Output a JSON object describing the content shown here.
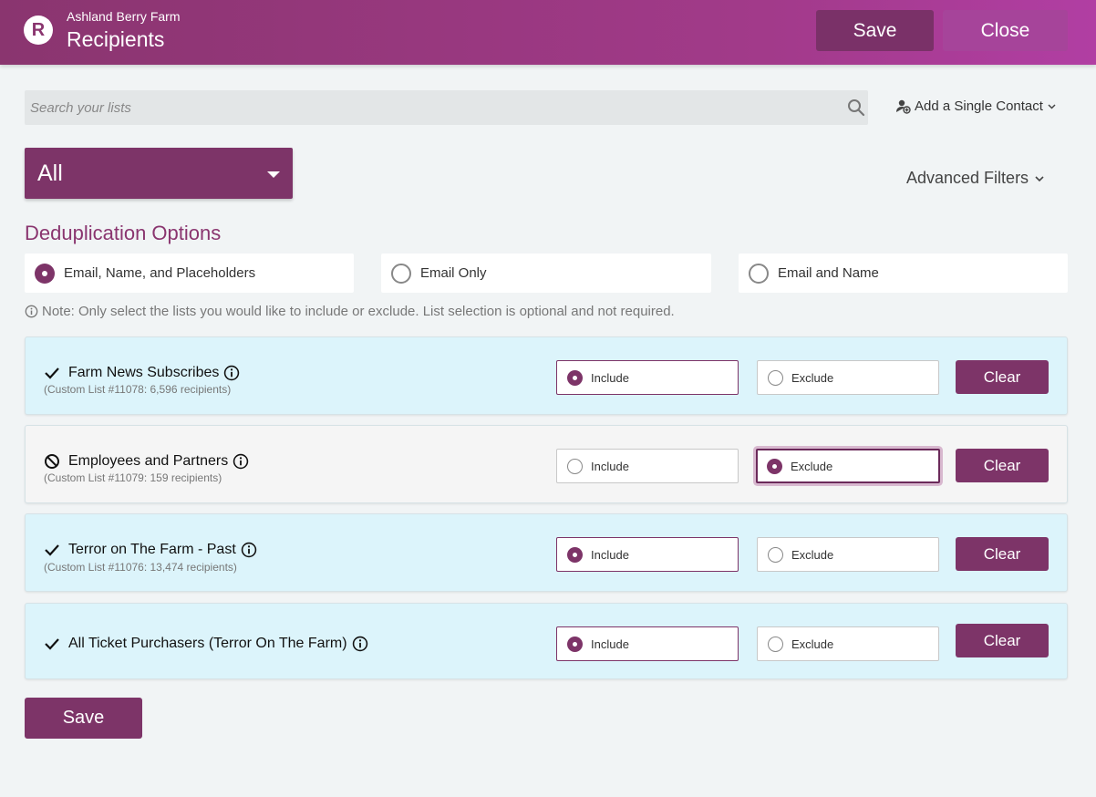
{
  "header": {
    "logo_letter": "R",
    "org_name": "Ashland Berry Farm",
    "title": "Recipients",
    "save_label": "Save",
    "close_label": "Close"
  },
  "search": {
    "placeholder": "Search your lists",
    "value": ""
  },
  "add_contact_label": "Add a Single Contact",
  "list_filter": {
    "selected": "All"
  },
  "advanced_filters_label": "Advanced Filters",
  "dedup": {
    "title": "Deduplication Options",
    "options": [
      {
        "label": "Email, Name, and Placeholders",
        "selected": true
      },
      {
        "label": "Email Only",
        "selected": false
      },
      {
        "label": "Email and Name",
        "selected": false
      }
    ]
  },
  "note": "Note: Only select the lists you would like to include or exclude. List selection is optional and not required.",
  "lists": [
    {
      "name": "Farm News Subscribes",
      "subtitle": "(Custom List #11078: 6,596 recipients)",
      "status": "include",
      "include_label": "Include",
      "exclude_label": "Exclude",
      "clear_label": "Clear"
    },
    {
      "name": "Employees and Partners",
      "subtitle": "(Custom List #11079: 159 recipients)",
      "status": "exclude",
      "include_label": "Include",
      "exclude_label": "Exclude",
      "clear_label": "Clear"
    },
    {
      "name": "Terror on The Farm - Past",
      "subtitle": "(Custom List #11076: 13,474 recipients)",
      "status": "include",
      "include_label": "Include",
      "exclude_label": "Exclude",
      "clear_label": "Clear"
    },
    {
      "name": "All Ticket Purchasers (Terror On The Farm)",
      "subtitle": "",
      "status": "include",
      "include_label": "Include",
      "exclude_label": "Exclude",
      "clear_label": "Clear"
    }
  ],
  "footer": {
    "save_label": "Save"
  },
  "colors": {
    "brand": "#7d3468",
    "header_start": "#8a356f",
    "header_end": "#b13ea3",
    "include_row": "#dcf4fb",
    "exclude_row": "#f5f5f5"
  }
}
